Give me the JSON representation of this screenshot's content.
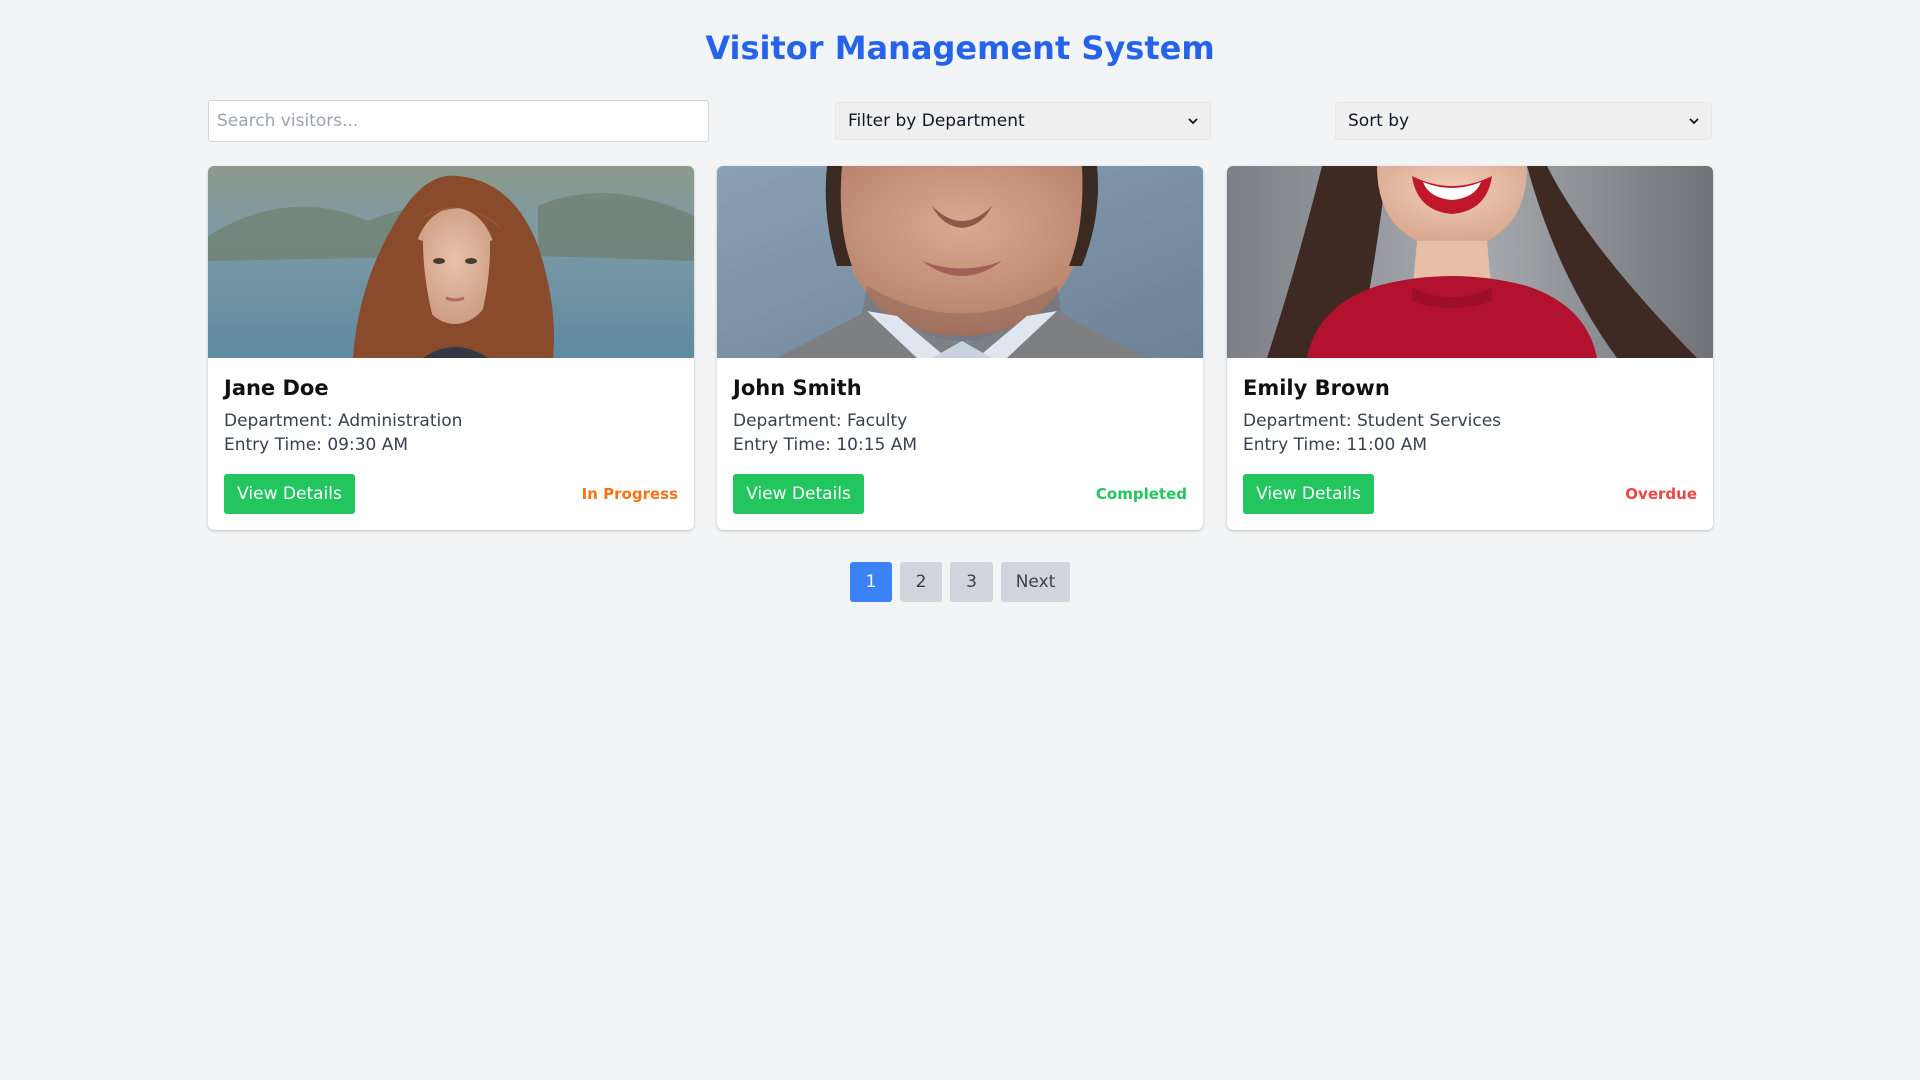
{
  "header": {
    "title": "Visitor Management System"
  },
  "controls": {
    "search_placeholder": "Search visitors...",
    "department_filter": "Filter by Department",
    "sort": "Sort by"
  },
  "visitors": [
    {
      "name": "Jane Doe",
      "department": "Department: Administration",
      "entry_time": "Entry Time: 09:30 AM",
      "button": "View Details",
      "status": "In Progress",
      "status_color": "#f97316"
    },
    {
      "name": "John Smith",
      "department": "Department: Faculty",
      "entry_time": "Entry Time: 10:15 AM",
      "button": "View Details",
      "status": "Completed",
      "status_color": "#22c55e"
    },
    {
      "name": "Emily Brown",
      "department": "Department: Student Services",
      "entry_time": "Entry Time: 11:00 AM",
      "button": "View Details",
      "status": "Overdue",
      "status_color": "#ef4444"
    }
  ],
  "pagination": {
    "pages": [
      "1",
      "2",
      "3"
    ],
    "current": "1",
    "next": "Next"
  },
  "colors": {
    "title": "#2563eb",
    "primary_button": "#22c55e",
    "active_page": "#3b82f6",
    "inactive_page": "#d1d5db",
    "background": "#f3f4f6"
  }
}
